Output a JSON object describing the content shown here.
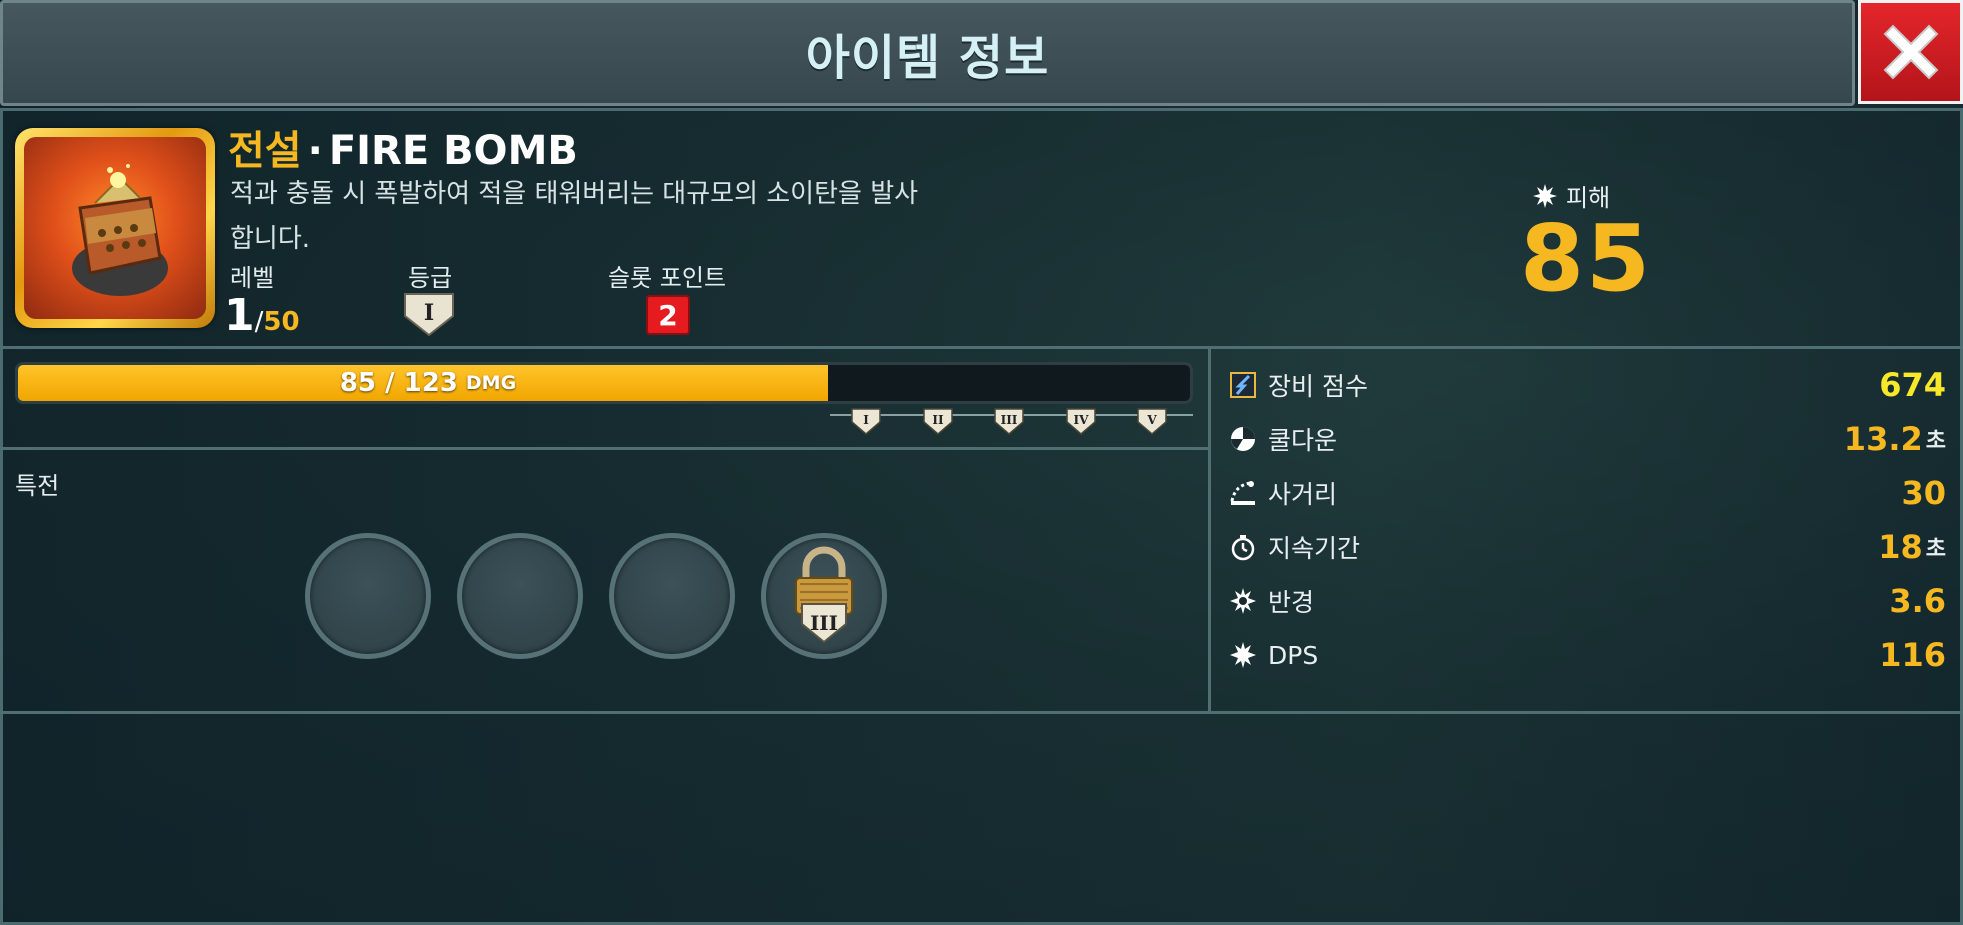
{
  "header": {
    "title": "아이템 정보"
  },
  "close_button": {
    "icon": "close-icon"
  },
  "item": {
    "rarity": "전설",
    "separator": "·",
    "name": "FIRE BOMB",
    "description": "적과 충돌 시 폭발하여 적을 태워버리는 대규모의 소이탄을 발사합니다.",
    "level_label": "레벨",
    "level_current": "1",
    "level_slash": "/",
    "level_max": "50",
    "tier_label": "등급",
    "tier_value": "I",
    "slot_label": "슬롯 포인트",
    "slot_value": "2"
  },
  "damage": {
    "label": "피해",
    "value": "85",
    "icon": "burst-icon"
  },
  "progress": {
    "text": "85 / 123",
    "unit": "DMG",
    "current": 85,
    "max": 123,
    "tiers": [
      "I",
      "II",
      "III",
      "IV",
      "V"
    ]
  },
  "perks": {
    "label": "특전",
    "slots": [
      {
        "state": "empty"
      },
      {
        "state": "empty"
      },
      {
        "state": "empty"
      },
      {
        "state": "locked",
        "tier": "III",
        "icon": "padlock-icon"
      }
    ]
  },
  "stats": [
    {
      "label": "장비 점수",
      "value": "674",
      "suffix": "",
      "icon": "gear-score-icon"
    },
    {
      "label": "쿨다운",
      "value": "13.2",
      "suffix": "초",
      "icon": "cooldown-icon"
    },
    {
      "label": "사거리",
      "value": "30",
      "suffix": "",
      "icon": "range-icon"
    },
    {
      "label": "지속기간",
      "value": "18",
      "suffix": "초",
      "icon": "stopwatch-icon"
    },
    {
      "label": "반경",
      "value": "3.6",
      "suffix": "",
      "icon": "radius-icon"
    },
    {
      "label": "DPS",
      "value": "116",
      "suffix": "",
      "icon": "burst-icon"
    }
  ],
  "colors": {
    "accent": "#f5b820",
    "score": "#f7e82a",
    "slot_badge": "#e51b20",
    "close": "#d81e24"
  }
}
